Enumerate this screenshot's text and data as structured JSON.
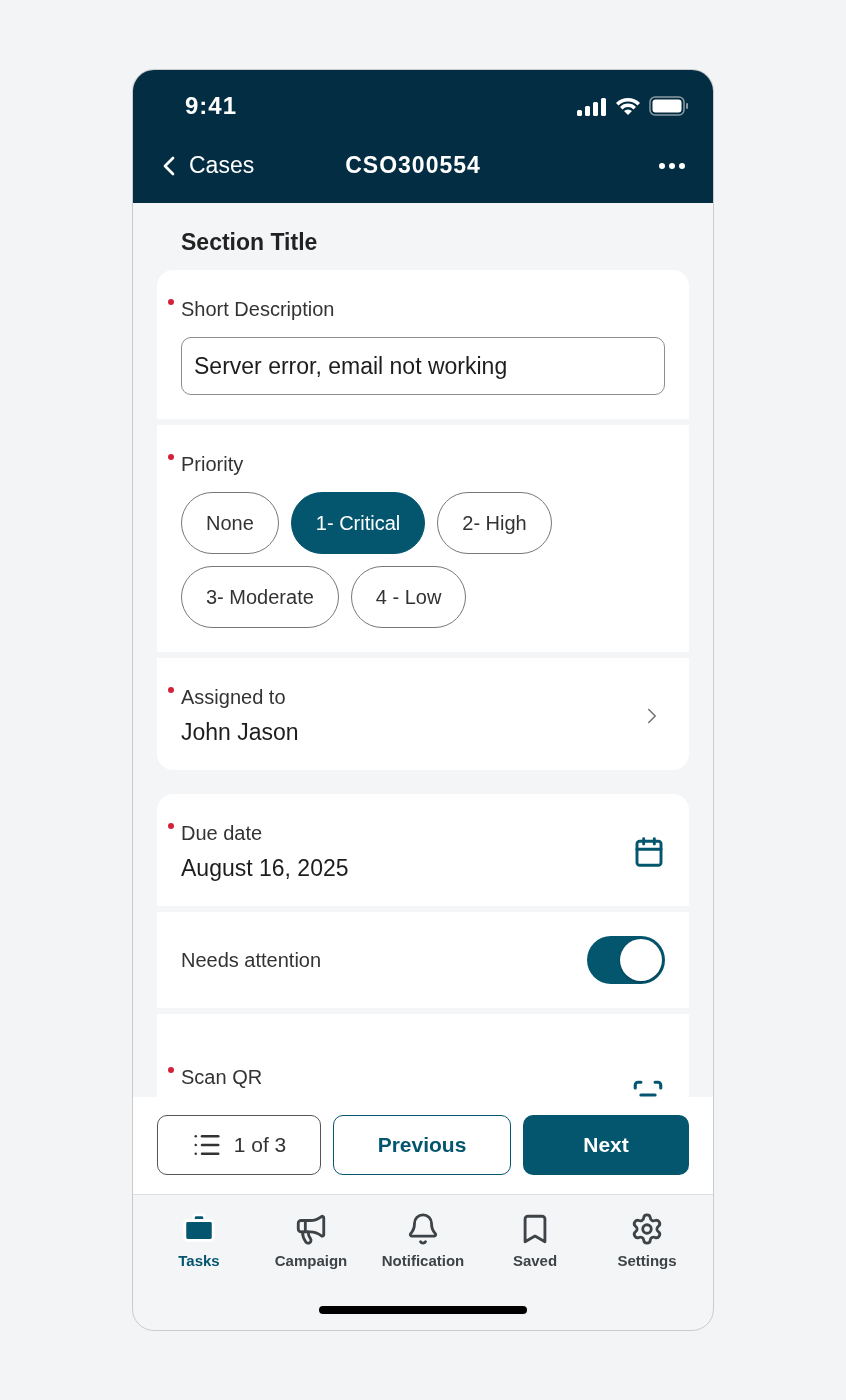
{
  "status_bar": {
    "time": "9:41"
  },
  "nav": {
    "back_label": "Cases",
    "title": "CSO300554"
  },
  "section_title": "Section Title",
  "groups": [
    {
      "fields": [
        {
          "kind": "text",
          "label": "Short Description",
          "required": true,
          "value": "Server error, email not working"
        },
        {
          "kind": "chips",
          "label": "Priority",
          "required": true,
          "options": [
            {
              "label": "None",
              "selected": false
            },
            {
              "label": "1- Critical",
              "selected": true
            },
            {
              "label": "2- High",
              "selected": false
            },
            {
              "label": "3- Moderate",
              "selected": false
            },
            {
              "label": "4 - Low",
              "selected": false
            }
          ]
        },
        {
          "kind": "link",
          "label": "Assigned to",
          "required": true,
          "value": "John Jason"
        }
      ]
    },
    {
      "fields": [
        {
          "kind": "date",
          "label": "Due date",
          "required": true,
          "value": "August 16, 2025"
        },
        {
          "kind": "toggle",
          "label": "Needs attention",
          "required": false,
          "on": true
        },
        {
          "kind": "scan",
          "label": "Scan QR",
          "required": true
        }
      ]
    }
  ],
  "pager": {
    "position": "1 of 3",
    "previous": "Previous",
    "next": "Next"
  },
  "tabs": [
    {
      "label": "Tasks",
      "selected": true
    },
    {
      "label": "Campaign",
      "selected": false
    },
    {
      "label": "Notification",
      "selected": false
    },
    {
      "label": "Saved",
      "selected": false
    },
    {
      "label": "Settings",
      "selected": false
    }
  ]
}
